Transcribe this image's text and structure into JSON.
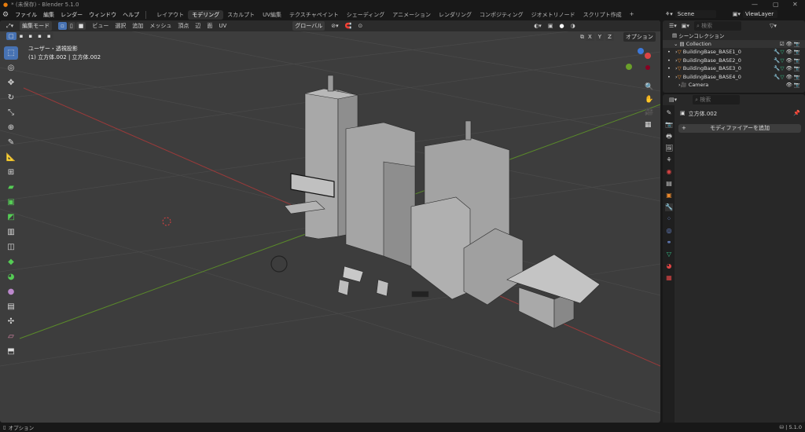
{
  "window": {
    "title": "* (未保存) - Blender 5.1.0"
  },
  "menu": [
    "ファイル",
    "編集",
    "レンダー",
    "ウィンドウ",
    "ヘルプ"
  ],
  "workspaces": [
    "レイアウト",
    "モデリング",
    "スカルプト",
    "UV編集",
    "テクスチャペイント",
    "シェーディング",
    "アニメーション",
    "レンダリング",
    "コンポジティング",
    "ジオメトリノード",
    "スクリプト作成",
    "+"
  ],
  "active_workspace": "モデリング",
  "scene": {
    "label": "Scene",
    "viewlayer": "ViewLayer"
  },
  "viewport_header": {
    "mode": "編集モード",
    "menus": [
      "ビュー",
      "選択",
      "追加",
      "メッシュ",
      "頂点",
      "辺",
      "面",
      "UV"
    ],
    "orientation": "グローバル",
    "axes": [
      "X",
      "Y",
      "Z"
    ],
    "options": "オプション"
  },
  "viewport_overlay": {
    "view": "ユーザー・透視投影",
    "object": "(1) 立方体.002 | 立方体.002"
  },
  "outliner": {
    "search_placeholder": "検索",
    "root": "シーンコレクション",
    "collection": "Collection",
    "items": [
      "BuildingBase_BASE1_0",
      "BuildingBase_BASE2_0",
      "BuildingBase_BASE3_0",
      "BuildingBase_BASE4_0",
      "Camera"
    ]
  },
  "properties": {
    "search_placeholder": "検索",
    "object": "立方体.002",
    "add_modifier": "モディファイアーを追加"
  },
  "statusbar": {
    "left": "オプション",
    "version": "5.1.0"
  },
  "colors": {
    "accent": "#4772b3",
    "mesh_orange": "#e8882c",
    "modifier_blue": "#6f8fd8",
    "data_green": "#35c28a"
  }
}
